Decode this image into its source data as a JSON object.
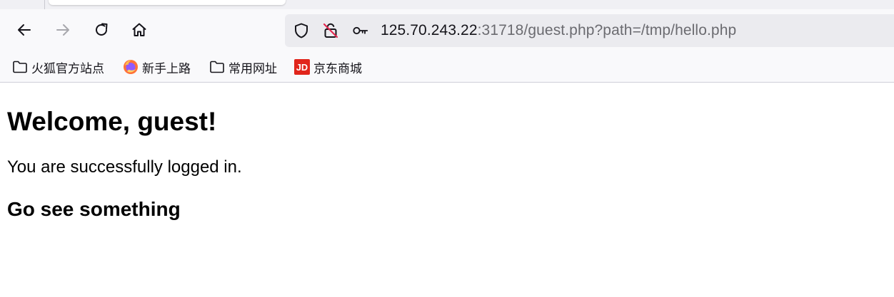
{
  "browser": {
    "url": {
      "host": "125.70.243.22",
      "rest": ":31718/guest.php?path=/tmp/hello.php"
    },
    "nav_icons": {
      "back": "back-arrow-icon",
      "forward": "forward-arrow-icon",
      "reload": "reload-icon",
      "home": "home-icon"
    },
    "urlbar_icons": [
      "shield-icon",
      "insecure-lock-icon",
      "key-icon"
    ],
    "bookmarks": [
      {
        "label": "火狐官方站点",
        "icon": "folder-icon"
      },
      {
        "label": "新手上路",
        "icon": "firefox-icon"
      },
      {
        "label": "常用网址",
        "icon": "folder-icon"
      },
      {
        "label": "京东商城",
        "icon": "jd-icon"
      }
    ]
  },
  "page": {
    "heading": "Welcome, guest!",
    "message": "You are successfully logged in.",
    "subheading": "Go see something"
  },
  "colors": {
    "toolbar_bg": "#f9f9fb",
    "urlbar_bg": "#ebebef",
    "text": "#15141a",
    "url_dim": "#6b6b70",
    "jd_red": "#e1251b"
  }
}
